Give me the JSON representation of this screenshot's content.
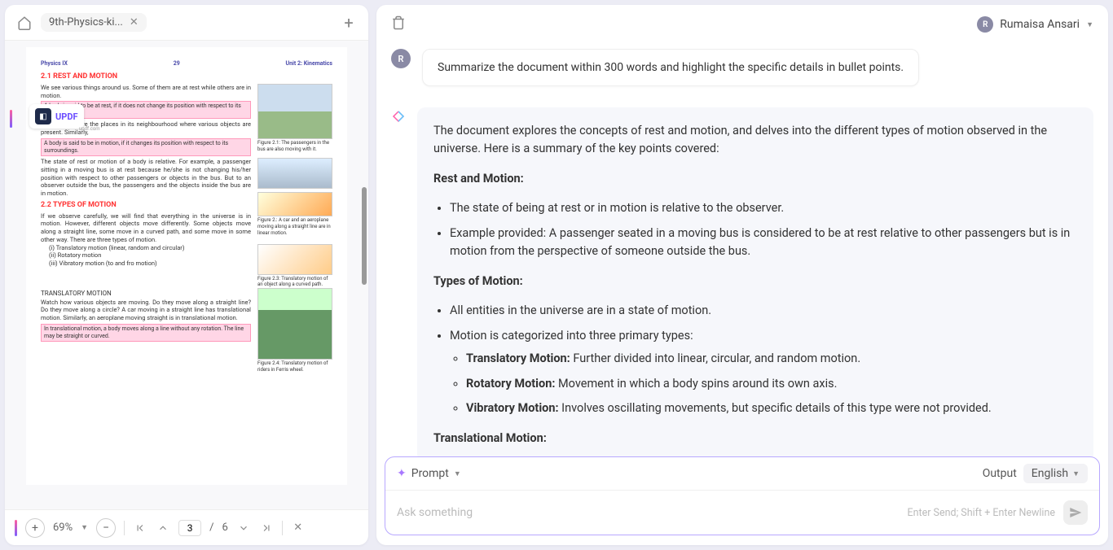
{
  "tab": {
    "title": "9th-Physics-ki...",
    "close": "✕"
  },
  "logo": {
    "text": "UPDF",
    "sub": "updf.com"
  },
  "doc": {
    "hdr_left": "Physics IX",
    "hdr_pg": "29",
    "hdr_right": "Unit 2: Kinematics",
    "s1": "2.1  REST AND MOTION",
    "p1": "We see various things around us. Some of them are at rest while others are in motion.",
    "h1": "A body is said to be at rest, if it does not change its position with respect to its surroundings.",
    "p2": "Surroundings are the places in its neighbourhood where various objects are present. Similarly,",
    "h2": "A body is said to be in motion, if it changes its position with respect to its surroundings.",
    "c1": "Figure 2.1: The passengers in the bus are also moving with it.",
    "p3": "The state of rest or motion of a body is relative. For example, a passenger sitting in a moving bus is at rest because he/she is not changing his/her position with respect to other passengers or objects in the bus. But to an observer outside the bus, the passengers and the objects inside the bus are in motion.",
    "s2": "2.2  TYPES OF MOTION",
    "p4": "If we observe carefully, we will find that everything in the universe is in motion. However, different objects move differently. Some objects move along a straight line, some move in a curved path, and some move in some other way. There are three types of motion.",
    "c2": "Figure 2.: A car and an aeroplane moving along a straight line are in linear motion.",
    "l1": "(i)   Translatory motion (linear, random and circular)",
    "l2": "(ii)  Rotatory motion",
    "l3": "(iii) Vibratory motion   (to and fro motion)",
    "c3": "Figure 2.3: Translatory motion of an object along a curved path.",
    "s3": "TRANSLATORY MOTION",
    "p5": "Watch how various objects are moving. Do they move along a straight line? Do they move along a circle? A car moving in a straight line has translational motion. Similarly, an aeroplane moving straight is in translational motion.",
    "h3": "In translational motion, a body moves along a line without any rotation. The line may be straight or curved.",
    "c4": "Figure 2.4: Translatory motion of riders in Ferris wheel."
  },
  "bb": {
    "zoom": "69%",
    "page": "3",
    "total": "6"
  },
  "user": {
    "name": "Rumaisa Ansari",
    "initial": "R"
  },
  "chat": {
    "q": "Summarize the document within 300 words and highlight the specific details in bullet points.",
    "intro": "The document explores the concepts of rest and motion, and delves into the different types of motion observed in the universe. Here is a summary of the key points covered:",
    "h1": "Rest and Motion:",
    "b1": "The state of being at rest or in motion is relative to the observer.",
    "b2": "Example provided: A passenger seated in a moving bus is considered to be at rest relative to other passengers but is in motion from the perspective of someone outside the bus.",
    "h2": "Types of Motion:",
    "b3": "All entities in the universe are in a state of motion.",
    "b4": "Motion is categorized into three primary types:",
    "b4a_l": "Translatory Motion:",
    "b4a_t": " Further divided into linear, circular, and random motion.",
    "b4b_l": "Rotatory Motion:",
    "b4b_t": " Movement in which a body spins around its own axis.",
    "b4c_l": "Vibratory Motion:",
    "b4c_t": " Involves oscillating movements, but specific details of this type were not provided.",
    "h3": "Translational Motion:"
  },
  "input": {
    "prompt": "Prompt",
    "output": "Output",
    "lang": "English",
    "placeholder": "Ask something",
    "hint": "Enter Send; Shift + Enter Newline"
  }
}
